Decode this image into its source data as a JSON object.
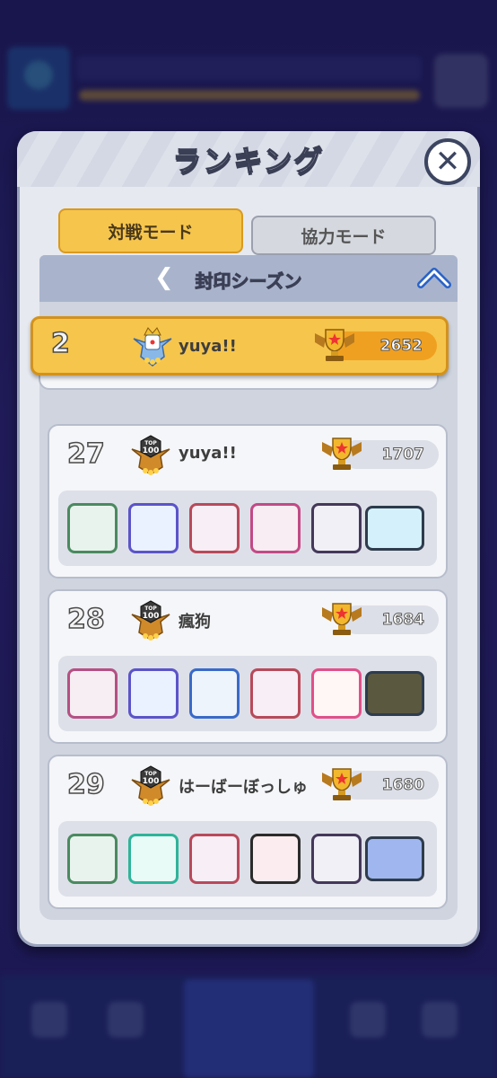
{
  "panel": {
    "title": "ランキング"
  },
  "tabs": {
    "versus": "対戦モード",
    "coop": "協力モード"
  },
  "season": {
    "title": "封印シーズン"
  },
  "my_rank": {
    "rank": "2",
    "name": "yuya!!",
    "score": "2652"
  },
  "rows": [
    {
      "rank": "27",
      "name": "yuya!!",
      "score": "1707"
    },
    {
      "rank": "28",
      "name": "瘋狗",
      "score": "1684"
    },
    {
      "rank": "29",
      "name": "はーばーぼっしゅ",
      "score": "1680"
    }
  ],
  "colors": {
    "accent": "#f6c54c",
    "panel": "#e6e9f0",
    "background": "#231d66"
  },
  "icons": {
    "close": "close-icon",
    "back": "chevron-left-icon",
    "collapse": "chevron-up-icon",
    "trophy": "trophy-icon",
    "top100": "top100-badge-icon"
  }
}
